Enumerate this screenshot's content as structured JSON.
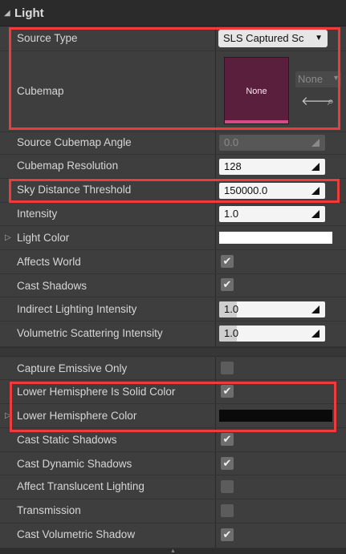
{
  "section": {
    "title": "Light"
  },
  "source_type": {
    "label": "Source Type",
    "value": "SLS Captured Sc"
  },
  "cubemap": {
    "label": "Cubemap",
    "thumb_text": "None",
    "asset_value": "None"
  },
  "rows": {
    "cubemap_angle": {
      "label": "Source Cubemap Angle",
      "value": "0.0"
    },
    "cubemap_resolution": {
      "label": "Cubemap Resolution",
      "value": "128"
    },
    "sky_distance": {
      "label": "Sky Distance Threshold",
      "value": "150000.0"
    },
    "intensity": {
      "label": "Intensity",
      "value": "1.0"
    },
    "light_color": {
      "label": "Light Color",
      "color": "#ffffff"
    },
    "affects_world": {
      "label": "Affects World",
      "checked": true
    },
    "cast_shadows": {
      "label": "Cast Shadows",
      "checked": true
    },
    "indirect_lighting": {
      "label": "Indirect Lighting Intensity",
      "value": "1.0"
    },
    "volumetric_scattering": {
      "label": "Volumetric Scattering Intensity",
      "value": "1.0"
    },
    "capture_emissive": {
      "label": "Capture Emissive Only",
      "checked": false
    },
    "lower_hemi_solid": {
      "label": "Lower Hemisphere Is Solid Color",
      "checked": true
    },
    "lower_hemi_color": {
      "label": "Lower Hemisphere Color",
      "color": "#0a0a0a"
    },
    "cast_static": {
      "label": "Cast Static Shadows",
      "checked": true
    },
    "cast_dynamic": {
      "label": "Cast Dynamic Shadows",
      "checked": true
    },
    "affect_translucent": {
      "label": "Affect Translucent Lighting",
      "checked": false
    },
    "transmission": {
      "label": "Transmission",
      "checked": false
    },
    "cast_volumetric": {
      "label": "Cast Volumetric Shadow",
      "checked": true
    }
  },
  "colors": {
    "highlight": "#ee3b3b",
    "panel": "#3e3e3e",
    "cubemap_thumb": "#5a1f3c",
    "cubemap_bar": "#d24b86"
  }
}
